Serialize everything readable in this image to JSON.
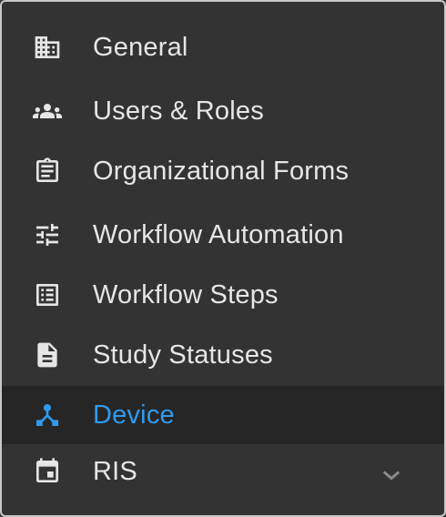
{
  "menu": {
    "items": [
      {
        "label": "General",
        "icon": "building-icon"
      },
      {
        "label": "Users & Roles",
        "icon": "group-icon"
      },
      {
        "label": "Organizational Forms",
        "icon": "clipboard-icon"
      },
      {
        "label": "Workflow Automation",
        "icon": "tune-sliders-icon"
      },
      {
        "label": "Workflow Steps",
        "icon": "list-icon"
      },
      {
        "label": "Study Statuses",
        "icon": "document-icon"
      },
      {
        "label": "Device",
        "icon": "device-hub-icon",
        "active": true
      },
      {
        "label": "RIS",
        "icon": "calendar-icon",
        "expandable": true
      }
    ]
  },
  "colors": {
    "background": "#333333",
    "active_background": "#262626",
    "text": "#e6e6e6",
    "accent": "#2f9bf0",
    "border": "#c8c8c8"
  }
}
